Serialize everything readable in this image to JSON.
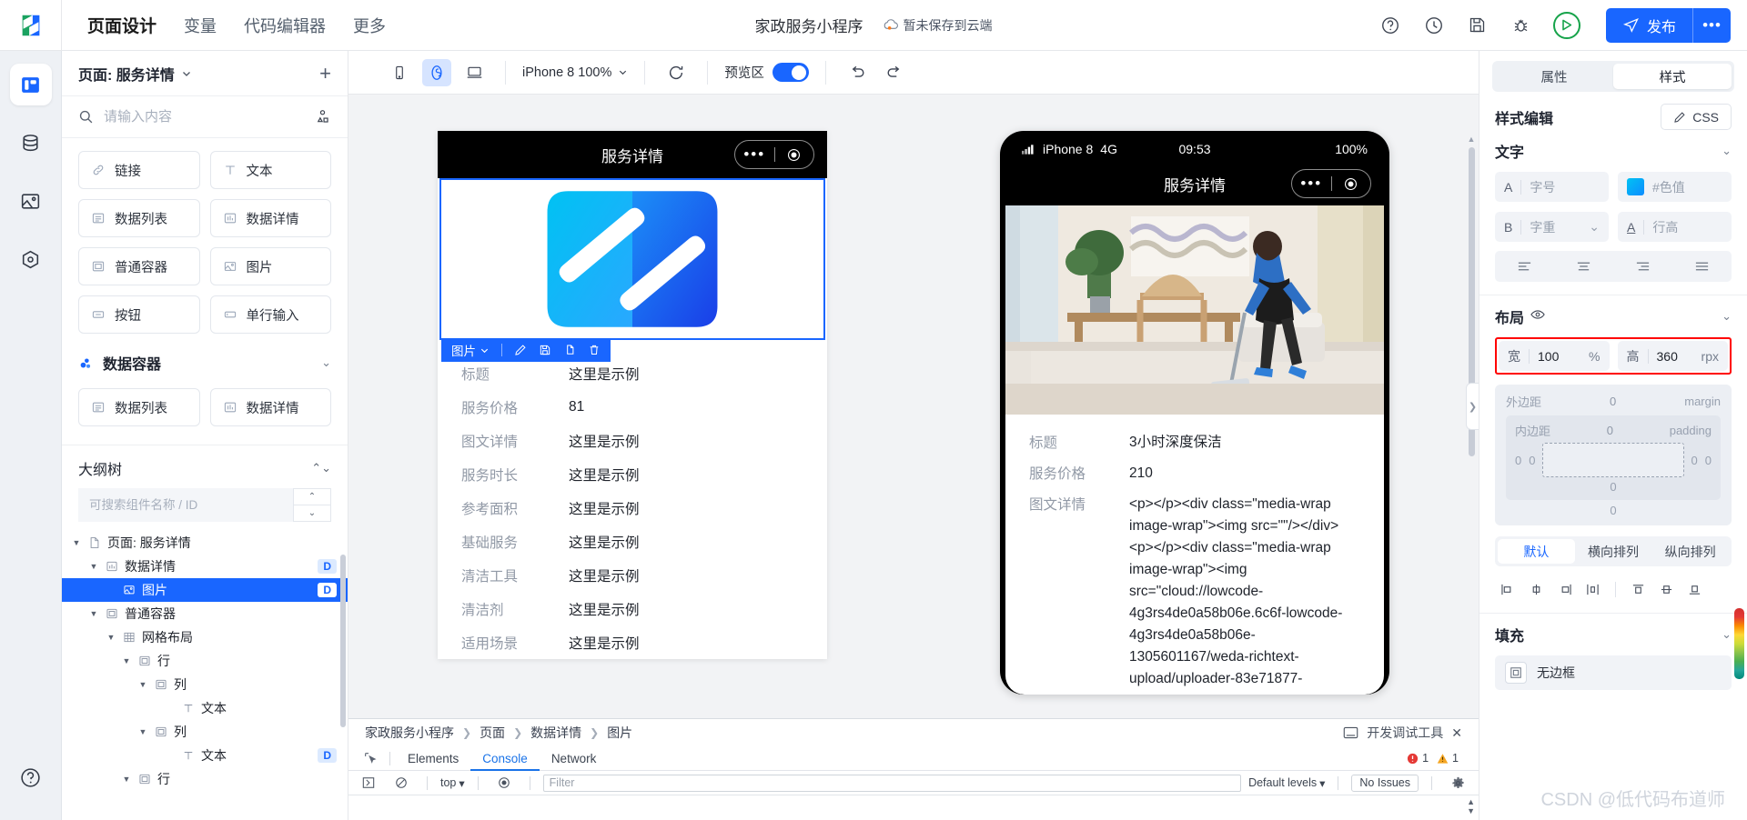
{
  "topbar": {
    "nav": [
      {
        "label": "页面设计",
        "active": true
      },
      {
        "label": "变量",
        "active": false
      },
      {
        "label": "代码编辑器",
        "active": false
      },
      {
        "label": "更多",
        "active": false
      }
    ],
    "project_name": "家政服务小程序",
    "save_state": "暂未保存到云端",
    "icons": [
      "help-icon",
      "history-icon",
      "save-icon",
      "bug-icon"
    ],
    "run_label": "run-icon",
    "publish_label": "发布",
    "more_label": "•••"
  },
  "rail": {
    "items": [
      {
        "name": "page-design-icon",
        "active": true
      },
      {
        "name": "database-icon",
        "active": false
      },
      {
        "name": "media-icon",
        "active": false
      },
      {
        "name": "settings-icon",
        "active": false
      }
    ],
    "help": "help-icon"
  },
  "leftpanel": {
    "page_title": "页面: 服务详情",
    "add_label": "+",
    "search_placeholder": "请输入内容",
    "components": [
      {
        "label": "链接",
        "icon": "link-icon"
      },
      {
        "label": "文本",
        "icon": "text-icon"
      },
      {
        "label": "数据列表",
        "icon": "list-icon"
      },
      {
        "label": "数据详情",
        "icon": "detail-icon"
      },
      {
        "label": "普通容器",
        "icon": "container-icon"
      },
      {
        "label": "图片",
        "icon": "image-icon"
      },
      {
        "label": "按钮",
        "icon": "button-icon"
      },
      {
        "label": "单行输入",
        "icon": "input-icon"
      }
    ],
    "data_container": {
      "title": "数据容器",
      "items": [
        {
          "label": "数据列表",
          "icon": "list-icon"
        },
        {
          "label": "数据详情",
          "icon": "detail-icon"
        }
      ]
    },
    "outline": {
      "title": "大纲树",
      "search_placeholder": "可搜索组件名称 / ID",
      "nodes": [
        {
          "label": "页面: 服务详情",
          "depth": 0,
          "caret": "▼",
          "icon": "page-icon",
          "badge": "",
          "selected": false
        },
        {
          "label": "数据详情",
          "depth": 1,
          "caret": "▼",
          "icon": "detail-icon",
          "badge": "D",
          "selected": false
        },
        {
          "label": "图片",
          "depth": 2,
          "caret": "",
          "icon": "image-icon",
          "badge": "D",
          "selected": true
        },
        {
          "label": "普通容器",
          "depth": 1,
          "caret": "▼",
          "icon": "container-icon",
          "badge": "",
          "selected": false
        },
        {
          "label": "网格布局",
          "depth": 2,
          "caret": "▼",
          "icon": "grid-icon",
          "badge": "",
          "selected": false
        },
        {
          "label": "行",
          "depth": 3,
          "caret": "▼",
          "icon": "container-icon",
          "badge": "",
          "selected": false
        },
        {
          "label": "列",
          "depth": 4,
          "caret": "▼",
          "icon": "container-icon",
          "badge": "",
          "selected": false
        },
        {
          "label": "文本",
          "depth": 5,
          "caret": "",
          "icon": "text-icon",
          "badge": "",
          "selected": false
        },
        {
          "label": "列",
          "depth": 4,
          "caret": "▼",
          "icon": "container-icon",
          "badge": "",
          "selected": false
        },
        {
          "label": "文本",
          "depth": 5,
          "caret": "",
          "icon": "text-icon",
          "badge": "D",
          "selected": false
        },
        {
          "label": "行",
          "depth": 3,
          "caret": "▼",
          "icon": "container-icon",
          "badge": "",
          "selected": false
        }
      ]
    }
  },
  "canvas_toolbar": {
    "device_buttons": [
      "phone-icon",
      "miniprogram-icon",
      "desktop-icon"
    ],
    "zoom_label": "iPhone 8 100%",
    "refresh_icon": "refresh-icon",
    "preview_label": "预览区",
    "preview_on": true,
    "undo_icon": "undo-icon",
    "redo_icon": "redo-icon"
  },
  "design_phone": {
    "nav_title": "服务详情",
    "selection_toolbar": {
      "label": "图片",
      "actions": [
        "edit-icon",
        "save-icon",
        "copy-icon",
        "delete-icon"
      ]
    },
    "fields": [
      {
        "label": "标题",
        "value": "这里是示例"
      },
      {
        "label": "服务价格",
        "value": "81"
      },
      {
        "label": "图文详情",
        "value": "这里是示例"
      },
      {
        "label": "服务时长",
        "value": "这里是示例"
      },
      {
        "label": "参考面积",
        "value": "这里是示例"
      },
      {
        "label": "基础服务",
        "value": "这里是示例"
      },
      {
        "label": "清洁工具",
        "value": "这里是示例"
      },
      {
        "label": "清洁剂",
        "value": "这里是示例"
      },
      {
        "label": "适用场景",
        "value": "这里是示例"
      }
    ]
  },
  "preview_phone": {
    "status": {
      "device": "iPhone 8",
      "network": "4G",
      "time": "09:53",
      "battery": "100%"
    },
    "nav_title": "服务详情",
    "fields": [
      {
        "label": "标题",
        "value": "3小时深度保洁"
      },
      {
        "label": "服务价格",
        "value": "210"
      },
      {
        "label": "图文详情",
        "value": "<p></p><div class=\"media-wrap image-wrap\"><img src=\"\"/></div><p></p><div class=\"media-wrap image-wrap\"><img src=\"cloud://lowcode-4g3rs4de0a58b06e.6c6f-lowcode-4g3rs4de0a58b06e-1305601167/weda-richtext-upload/uploader-83e71877-"
      }
    ]
  },
  "devtools": {
    "breadcrumb": [
      "家政服务小程序",
      "页面",
      "数据详情",
      "图片"
    ],
    "panel_label": "开发调试工具",
    "close_label": "✕",
    "tabs": [
      {
        "label": "Elements",
        "active": false
      },
      {
        "label": "Console",
        "active": true
      },
      {
        "label": "Network",
        "active": false
      }
    ],
    "error_count": "1",
    "warning_count": "1",
    "context_label": "top",
    "filter_placeholder": "Filter",
    "levels_label": "Default levels",
    "issues_label": "No Issues",
    "settings_icon": "gear-icon"
  },
  "rightpanel": {
    "tabs": [
      {
        "label": "属性",
        "active": false
      },
      {
        "label": "样式",
        "active": true
      }
    ],
    "style_edit_title": "样式编辑",
    "css_button": "CSS",
    "text_section": {
      "title": "文字",
      "font_size_label": "A",
      "font_size_placeholder": "字号",
      "color_swatch": "#00b4ff",
      "color_placeholder": "#色值",
      "weight_label": "B",
      "weight_placeholder": "字重",
      "lineheight_label": "A",
      "lineheight_placeholder": "行高",
      "aligns": [
        "align-left-icon",
        "align-center-icon",
        "align-right-icon",
        "align-justify-icon"
      ]
    },
    "layout_section": {
      "title": "布局",
      "eye_icon": "eye-icon",
      "width_label": "宽",
      "width_value": "100",
      "width_unit": "%",
      "height_label": "高",
      "height_value": "360",
      "height_unit": "rpx",
      "margin_label": "外边距",
      "margin_label_en": "margin",
      "padding_label": "内边距",
      "padding_label_en": "padding",
      "margin_top": "0",
      "margin_right": "0",
      "margin_bottom": "0",
      "margin_left": "0",
      "padding_top": "0",
      "padding_right": "0",
      "padding_bottom": "0",
      "padding_left": "0",
      "direction_tabs": [
        {
          "label": "默认",
          "active": true
        },
        {
          "label": "横向排列",
          "active": false
        },
        {
          "label": "纵向排列",
          "active": false
        }
      ]
    },
    "fill_section": {
      "title": "填充",
      "item_label": "无边框",
      "item_icon": "border-none-icon"
    },
    "watermark": "CSDN @低代码布道师"
  }
}
